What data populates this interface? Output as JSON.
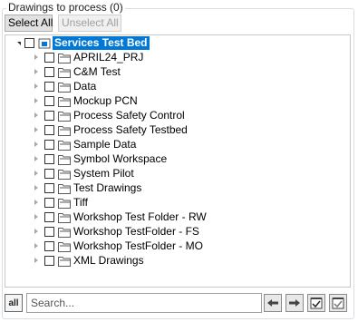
{
  "group_title": "Drawings to process (0)",
  "buttons": {
    "select_all": "Select All",
    "unselect_all": "Unselect All"
  },
  "tree": {
    "root": {
      "label": "Services Test Bed",
      "expanded": true,
      "checked": false
    },
    "items": [
      {
        "label": "APRIL24_PRJ"
      },
      {
        "label": "C&M Test"
      },
      {
        "label": "Data"
      },
      {
        "label": "Mockup PCN"
      },
      {
        "label": "Process Safety Control"
      },
      {
        "label": "Process Safety Testbed"
      },
      {
        "label": "Sample Data"
      },
      {
        "label": "Symbol Workspace"
      },
      {
        "label": "System Pilot"
      },
      {
        "label": "Test Drawings"
      },
      {
        "label": "Tiff"
      },
      {
        "label": "Workshop Test Folder - RW"
      },
      {
        "label": "Workshop TestFolder - FS"
      },
      {
        "label": "Workshop TestFolder - MO"
      },
      {
        "label": "XML Drawings"
      }
    ]
  },
  "search": {
    "placeholder": "Search...",
    "value": ""
  },
  "filter_button_label": "all",
  "icons": [
    "filter-all-icon",
    "arrow-left-icon",
    "arrow-right-icon",
    "check-all-icon",
    "uncheck-all-icon"
  ]
}
